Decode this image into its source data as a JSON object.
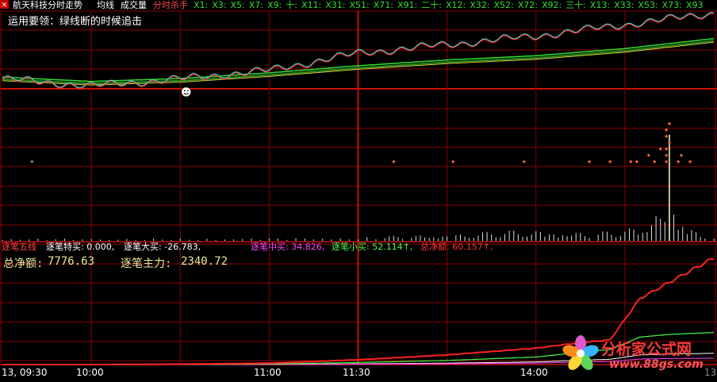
{
  "header": {
    "stock_title": "航天科技分时走势",
    "avg_line": "均线",
    "volume": "成交量",
    "indicator": "分时杀手",
    "ma_labels": [
      "X1:",
      "X3:",
      "X5:",
      "X7:",
      "X9:",
      "十:",
      "X11:",
      "X31:",
      "X51:",
      "X71:",
      "X91:",
      "二十:",
      "X12:",
      "X32:",
      "X52:",
      "X72:",
      "X92:",
      "三十:",
      "X13:",
      "X33:",
      "X53:",
      "X73:",
      "X93"
    ]
  },
  "hint": "运用要领：绿线断的时候追击",
  "lower_legend": {
    "title": "逐笔五线",
    "items": [
      {
        "label": "逐笔特买:",
        "value": "0.000,",
        "color": "#ffffff"
      },
      {
        "label": "逐笔大买:",
        "value": "-26.783,",
        "color": "#ffffff"
      },
      {
        "label": "逐笔中买:",
        "value": "34.826,",
        "color": "#ff44ff"
      },
      {
        "label": "逐笔小买:",
        "value": "52.114↑,",
        "color": "#44ff44"
      },
      {
        "label": "总净额:",
        "value": "60.157↑,",
        "color": "#ff3333"
      }
    ]
  },
  "net_amount": {
    "label": "总净额:",
    "value": "7776.63"
  },
  "main_force": {
    "label": "逐笔主力:",
    "value": "2340.72"
  },
  "time_axis": [
    "13, 09:30",
    "10:00",
    "11:00",
    "11:30",
    "14:00"
  ],
  "right_edge_label": "13",
  "logo": {
    "text": "分析家公式网",
    "url": "www.88gs.com"
  },
  "colors": {
    "grid": "#8b0000",
    "accent_red": "#ff2020",
    "green": "#33dd33",
    "yellow": "#dddd33",
    "cyan": "#33dddd"
  },
  "chart_data": [
    {
      "type": "line",
      "title": "航天科技分时走势",
      "x": [
        0,
        30,
        60,
        90,
        120,
        150,
        180,
        210,
        240
      ],
      "series": [
        {
          "values": [
            0.0,
            -0.5,
            0.0,
            0.6,
            1.8,
            2.4,
            3.0,
            3.8,
            4.6
          ]
        },
        {
          "values": [
            0.0,
            -0.3,
            -0.1,
            0.3,
            0.8,
            1.2,
            1.5,
            2.0,
            2.7
          ]
        }
      ]
    },
    {
      "type": "bar",
      "x": [
        0,
        60,
        120,
        150,
        180,
        200,
        215,
        225,
        235
      ],
      "values": [
        2,
        2,
        3,
        6,
        10,
        7,
        12,
        40,
        4
      ]
    },
    {
      "type": "line",
      "x": [
        0,
        30,
        60,
        90,
        120,
        150,
        180,
        195,
        205,
        215,
        225,
        240
      ],
      "series": [
        {
          "values": [
            0,
            0,
            30,
            100,
            350,
            700,
            1200,
            1600,
            1800,
            4800,
            6000,
            7776.63
          ]
        },
        {
          "values": [
            0,
            0,
            10,
            40,
            150,
            300,
            550,
            900,
            1100,
            2000,
            2200,
            2340.72
          ]
        }
      ]
    }
  ]
}
